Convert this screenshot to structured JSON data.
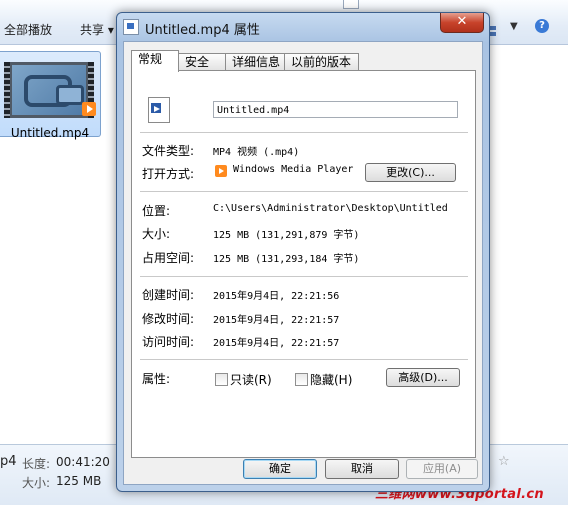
{
  "explorer": {
    "toolbar": {
      "play_all": "全部播放",
      "share": "共享",
      "share_arrow": "▾"
    },
    "file": {
      "name": "Untitled.mp4"
    },
    "details": {
      "name_partial": "p4",
      "duration_label": "长度:",
      "duration_value": "00:41:20",
      "size_label": "大小:",
      "size_value": "125 MB"
    },
    "watermark": "三维网www.3dportal.cn"
  },
  "dialog": {
    "title": "Untitled.mp4 属性",
    "close": "✕",
    "tabs": [
      {
        "label": "常规",
        "active": true
      },
      {
        "label": "安全",
        "active": false
      },
      {
        "label": "详细信息",
        "active": false
      },
      {
        "label": "以前的版本",
        "active": false
      }
    ],
    "general": {
      "filename": "Untitled.mp4",
      "type_label": "文件类型:",
      "type_value": "MP4 视频 (.mp4)",
      "opens_label": "打开方式:",
      "opens_value": "Windows Media Player",
      "change_button": "更改(C)...",
      "location_label": "位置:",
      "location_value": "C:\\Users\\Administrator\\Desktop\\Untitled",
      "size_label": "大小:",
      "size_value": "125 MB (131,291,879 字节)",
      "size_on_disk_label": "占用空间:",
      "size_on_disk_value": "125 MB (131,293,184 字节)",
      "created_label": "创建时间:",
      "created_value": "2015年9月4日, 22:21:56",
      "modified_label": "修改时间:",
      "modified_value": "2015年9月4日, 22:21:57",
      "accessed_label": "访问时间:",
      "accessed_value": "2015年9月4日, 22:21:57",
      "attributes_label": "属性:",
      "readonly_label": "只读(R)",
      "readonly_checked": false,
      "hidden_label": "隐藏(H)",
      "hidden_checked": false,
      "advanced_button": "高级(D)..."
    },
    "buttons": {
      "ok": "确定",
      "cancel": "取消",
      "apply": "应用(A)"
    }
  }
}
